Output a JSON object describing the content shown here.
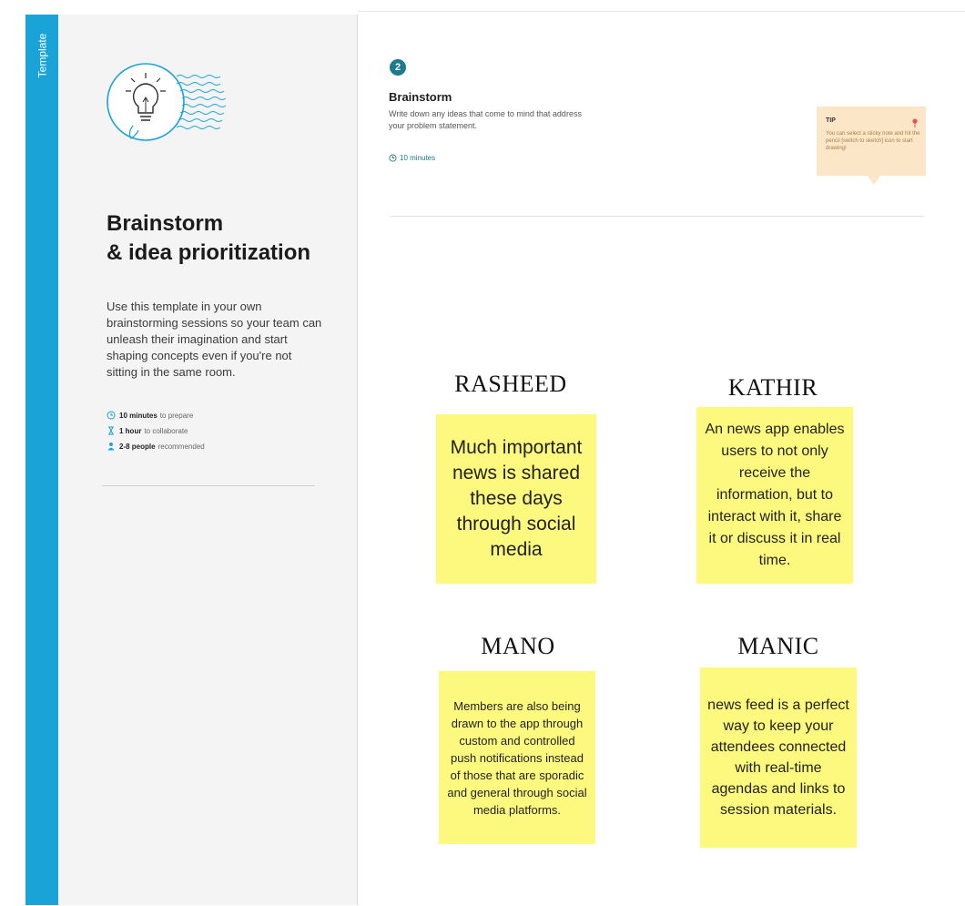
{
  "rail": {
    "label": "Template"
  },
  "intro": {
    "title_line1": "Brainstorm",
    "title_line2": "& idea prioritization",
    "description": "Use this template in your own brainstorming sessions so your team can unleash their imagination and start shaping concepts even if you're not sitting in the same room.",
    "meta": [
      {
        "icon": "clock-icon",
        "value": "10 minutes",
        "suffix": "to prepare"
      },
      {
        "icon": "hourglass-icon",
        "value": "1 hour",
        "suffix": "to collaborate"
      },
      {
        "icon": "person-icon",
        "value": "2-8 people",
        "suffix": "recommended"
      }
    ]
  },
  "step": {
    "number": "2",
    "title": "Brainstorm",
    "description": "Write down any ideas that come to mind that address your problem statement.",
    "time": "10 minutes"
  },
  "tip": {
    "label": "TIP",
    "text": "You can select a sticky note and hit the pencil [switch to sketch] icon to start drawing!"
  },
  "ideas": [
    {
      "author": "RASHEED",
      "text": "Much important news is shared these days through social media"
    },
    {
      "author": "KATHIR",
      "text": "An news app enables users to not only receive the information, but to interact with it, share it or discuss it in real time."
    },
    {
      "author": "MANO",
      "text": "Members are also being drawn to the app through custom and controlled push notifications instead of those that are sporadic and general through social media platforms."
    },
    {
      "author": "MANIC",
      "text": "news feed is a perfect way to keep your attendees connected with real-time agendas and links to session materials."
    }
  ],
  "colors": {
    "rail": "#1aa3d6",
    "accent": "#1c7a8c",
    "sticky": "#fdf97e",
    "tip": "#fbe6c8"
  }
}
